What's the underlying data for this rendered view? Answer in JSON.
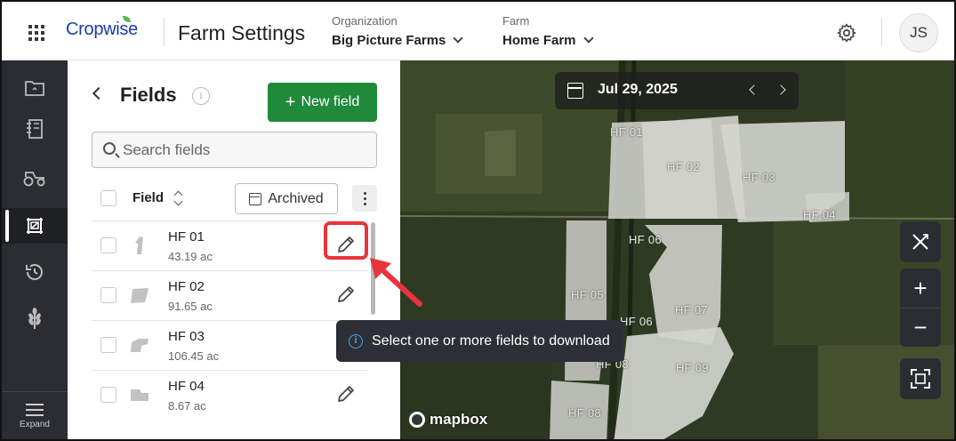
{
  "header": {
    "logo": "Cropwise",
    "app_title": "Farm Settings",
    "organization_label": "Organization",
    "organization_value": "Big Picture Farms",
    "farm_label": "Farm",
    "farm_value": "Home Farm",
    "avatar_initials": "JS"
  },
  "rail": {
    "items": [
      "folder-icon",
      "notebook-icon",
      "tractor-icon",
      "fields-icon",
      "history-icon",
      "crop-icon"
    ],
    "active": "fields-icon",
    "expand_label": "Expand"
  },
  "panel": {
    "title": "Fields",
    "info": "i",
    "new_field_label": "New field",
    "search_placeholder": "Search fields",
    "column_header": "Field",
    "archived_label": "Archived",
    "rows": [
      {
        "name": "HF 01",
        "area": "43.19 ac"
      },
      {
        "name": "HF 02",
        "area": "91.65 ac"
      },
      {
        "name": "HF 03",
        "area": "106.45 ac"
      },
      {
        "name": "HF 04",
        "area": "8.67 ac"
      }
    ]
  },
  "map": {
    "date": "Jul 29, 2025",
    "field_labels": [
      "HF 01",
      "HF 02",
      "HF 03",
      "HF 04",
      "HF 06",
      "HF 05",
      "HF 06",
      "HF 07",
      "HF 08",
      "HF 09",
      "HF 08"
    ],
    "tooltip_info": "i",
    "tooltip": "Select one or more fields to download",
    "attribution": "mapbox"
  },
  "colors": {
    "primary_green": "#1f8a3a",
    "brand_blue": "#1a3ea8",
    "rail_bg": "#2b2d33",
    "highlight_red": "#e8343c",
    "info_blue": "#4ea2f0"
  }
}
